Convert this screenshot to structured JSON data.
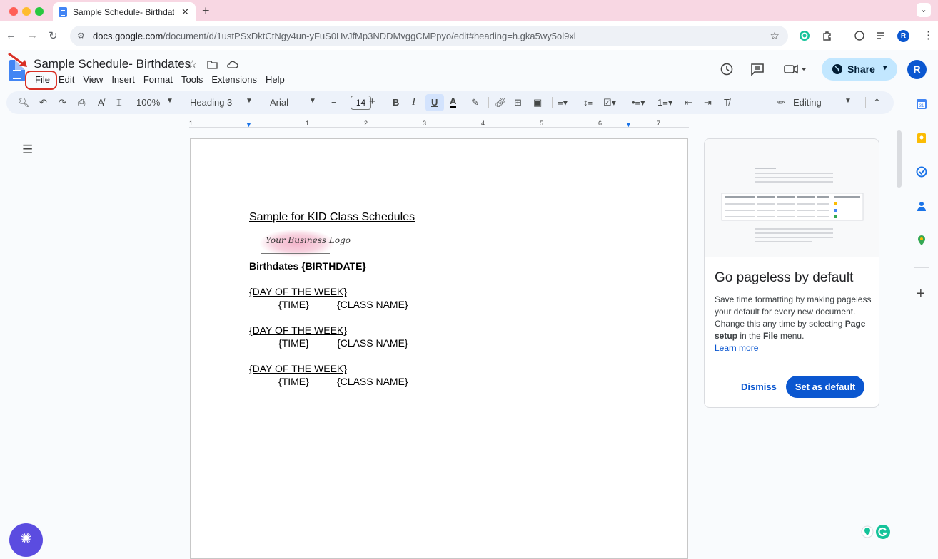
{
  "browser": {
    "tab_title": "Sample Schedule- Birthdates",
    "tab_close": "✕",
    "new_tab": "+",
    "url_host": "docs.google.com",
    "url_path": "/document/d/1ustPSxDktCtNgy4un-yFuS0HvJfMp3NDDMvggCMPpyo/edit#heading=h.gka5wy5ol9xl",
    "icons": [
      "back-icon",
      "forward-icon",
      "reload-icon",
      "site-info-icon",
      "bookmark-star-icon",
      "grammarly-icon",
      "extensions-icon",
      "profile-avatar"
    ],
    "profile_initial": "R"
  },
  "docs": {
    "title": "Sample Schedule- Birthdates",
    "menu": [
      "File",
      "Edit",
      "View",
      "Insert",
      "Format",
      "Tools",
      "Extensions",
      "Help"
    ],
    "share_label": "Share",
    "avatar_initial": "R"
  },
  "toolbar": {
    "zoom": "100%",
    "style": "Heading 3",
    "font": "Arial",
    "font_size": "14",
    "minus": "−",
    "plus": "+",
    "bold": "B",
    "italic": "I",
    "underline": "U",
    "text_color": "A",
    "mode": "Editing"
  },
  "ruler": [
    "1",
    "1",
    "2",
    "3",
    "4",
    "5",
    "6",
    "7"
  ],
  "document": {
    "heading": "Sample for KID Class Schedules",
    "logo_text": "Your Business Logo",
    "birthdates": "Birthdates {BIRTHDATE}",
    "blocks": [
      {
        "day": "{DAY OF THE WEEK}",
        "time": "{TIME}",
        "class": "{CLASS NAME}"
      },
      {
        "day": "{DAY OF THE WEEK}",
        "time": "{TIME}",
        "class": "{CLASS NAME}"
      },
      {
        "day": "{DAY OF THE WEEK}",
        "time": "{TIME}",
        "class": "{CLASS NAME}"
      }
    ]
  },
  "card": {
    "title": "Go pageless by default",
    "body_1": "Save time formatting by making pageless your default for every new document. Change this any time by selecting ",
    "body_bold_1": "Page setup",
    "body_2": " in the ",
    "body_bold_2": "File",
    "body_3": " menu.",
    "link": "Learn more",
    "dismiss": "Dismiss",
    "set_default": "Set as default"
  },
  "colors": {
    "accent": "#0b57d0",
    "share_bg": "#c2e7ff",
    "tabbar": "#f8d7e3",
    "annotation": "#d93025"
  }
}
